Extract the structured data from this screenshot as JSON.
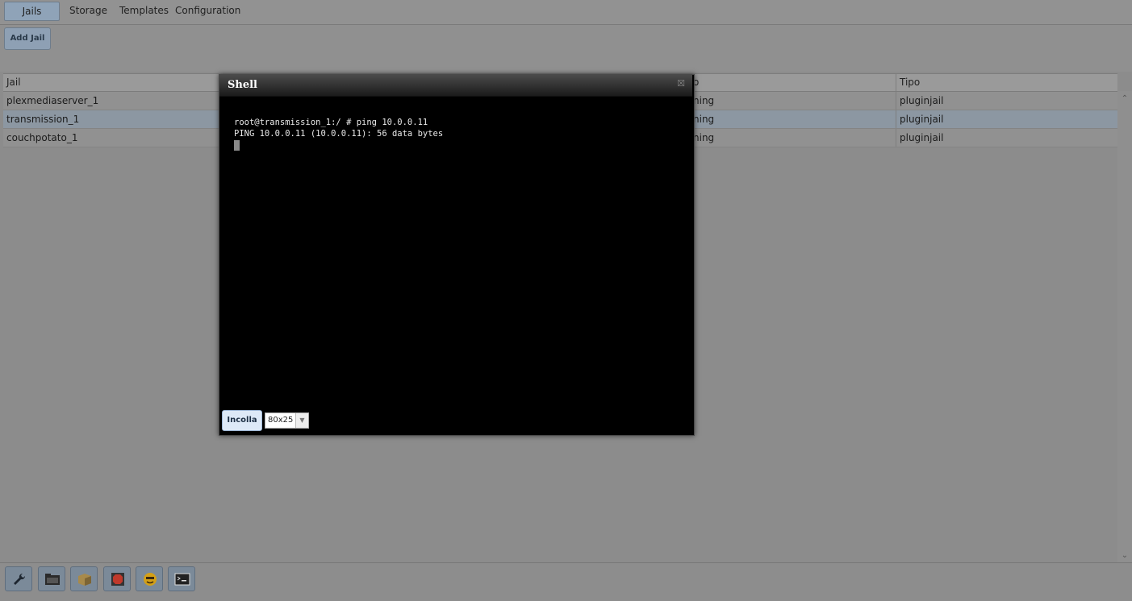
{
  "tabs": {
    "jails": "Jails",
    "storage": "Storage",
    "templates": "Templates",
    "configuration": "Configuration"
  },
  "toolbar": {
    "add_jail": "Add Jail"
  },
  "grid": {
    "headers": {
      "jail": "Jail",
      "status": "o",
      "type": "Tipo"
    },
    "rows": [
      {
        "jail": "plexmediaserver_1",
        "status": "ning",
        "type": "pluginjail"
      },
      {
        "jail": "transmission_1",
        "status": "ning",
        "type": "pluginjail"
      },
      {
        "jail": "couchpotato_1",
        "status": "ning",
        "type": "pluginjail"
      }
    ]
  },
  "dialog": {
    "title": "Shell",
    "close_icon": "close-icon",
    "terminal": {
      "line1": "root@transmission_1:/ # ping 10.0.0.11",
      "line2": "PING 10.0.0.11 (10.0.0.11): 56 data bytes"
    },
    "paste_label": "Incolla",
    "size_value": "80x25"
  },
  "bottom_icons": [
    "wrench-icon",
    "folder-icon",
    "package-icon",
    "stop-icon",
    "face-icon",
    "terminal-icon"
  ],
  "colors": {
    "terminal_bg": "#000000",
    "terminal_fg": "#e8e8e8",
    "accent": "#8fa3b8"
  }
}
